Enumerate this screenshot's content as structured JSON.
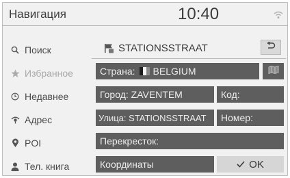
{
  "header": {
    "title": "Навигация",
    "time": "10:40"
  },
  "sidebar": {
    "items": [
      {
        "label": "Поиск",
        "icon": "search-icon",
        "enabled": true
      },
      {
        "label": "Избранное",
        "icon": "star-icon",
        "enabled": false
      },
      {
        "label": "Недавнее",
        "icon": "clock-icon",
        "enabled": true
      },
      {
        "label": "Адрес",
        "icon": "address-icon",
        "enabled": true
      },
      {
        "label": "POI",
        "icon": "pin-icon",
        "enabled": true
      },
      {
        "label": "Тел. книга",
        "icon": "person-icon",
        "enabled": true
      }
    ]
  },
  "destination": {
    "name": "STATIONSSTRAAT"
  },
  "form": {
    "country_label": "Страна:",
    "country_value": "BELGIUM",
    "flag_colors": [
      "#1e1e1e",
      "#f5f5f5",
      "#8a8a8a"
    ],
    "city": "Город: ZAVENTEM",
    "code": "Код:",
    "street": "Улица: STATIONSSTRAAT",
    "number": "Номер:",
    "intersection": "Перекресток:",
    "coordinates": "Координаты",
    "ok": "OK"
  },
  "colors": {
    "field_bg": "#5e5e5e",
    "field_text": "#ececec",
    "screen_bg": "#f1f1f1"
  }
}
